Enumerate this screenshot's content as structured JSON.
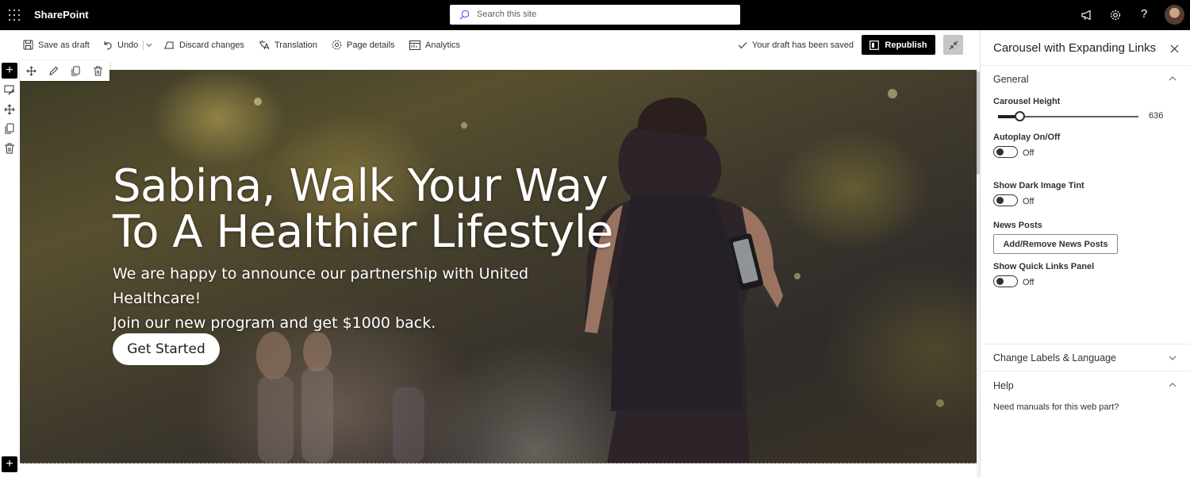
{
  "suitebar": {
    "app_name": "SharePoint",
    "search_placeholder": "Search this site"
  },
  "commandbar": {
    "save_draft": "Save as draft",
    "undo": "Undo",
    "discard": "Discard changes",
    "translation": "Translation",
    "page_details": "Page details",
    "analytics": "Analytics",
    "status": "Your draft has been saved",
    "republish": "Republish"
  },
  "hero": {
    "title_line1": "Sabina, Walk Your Way",
    "title_line2": "To A Healthier Lifestyle",
    "subtitle_line1": "We are happy to announce our partnership with United Healthcare!",
    "subtitle_line2": "Join our new program and get $1000 back.",
    "cta": "Get Started"
  },
  "pane": {
    "title": "Carousel with Expanding Links",
    "general": "General",
    "carousel_height_label": "Carousel Height",
    "carousel_height_value": "636",
    "autoplay_label": "Autoplay On/Off",
    "autoplay_state": "Off",
    "dark_tint_label": "Show Dark Image Tint",
    "dark_tint_state": "Off",
    "news_posts_label": "News Posts",
    "news_posts_button": "Add/Remove News Posts",
    "quick_links_label": "Show Quick Links Panel",
    "quick_links_state": "Off",
    "change_labels": "Change Labels & Language",
    "help": "Help",
    "help_text": "Need manuals for this web part?"
  },
  "colors": {
    "suitebar_bg": "#000000",
    "primary_button": "#000000",
    "pane_divider": "#edebe9"
  },
  "icons": [
    "waffle-icon",
    "search-icon",
    "megaphone-icon",
    "gear-icon",
    "help-icon",
    "save-icon",
    "undo-icon",
    "discard-icon",
    "translation-icon",
    "page-details-icon",
    "analytics-icon",
    "checkmark-icon",
    "republish-icon",
    "collapse-icon",
    "close-icon",
    "chevron-up-icon",
    "chevron-down-icon",
    "move-icon",
    "edit-icon",
    "duplicate-icon",
    "delete-icon"
  ]
}
